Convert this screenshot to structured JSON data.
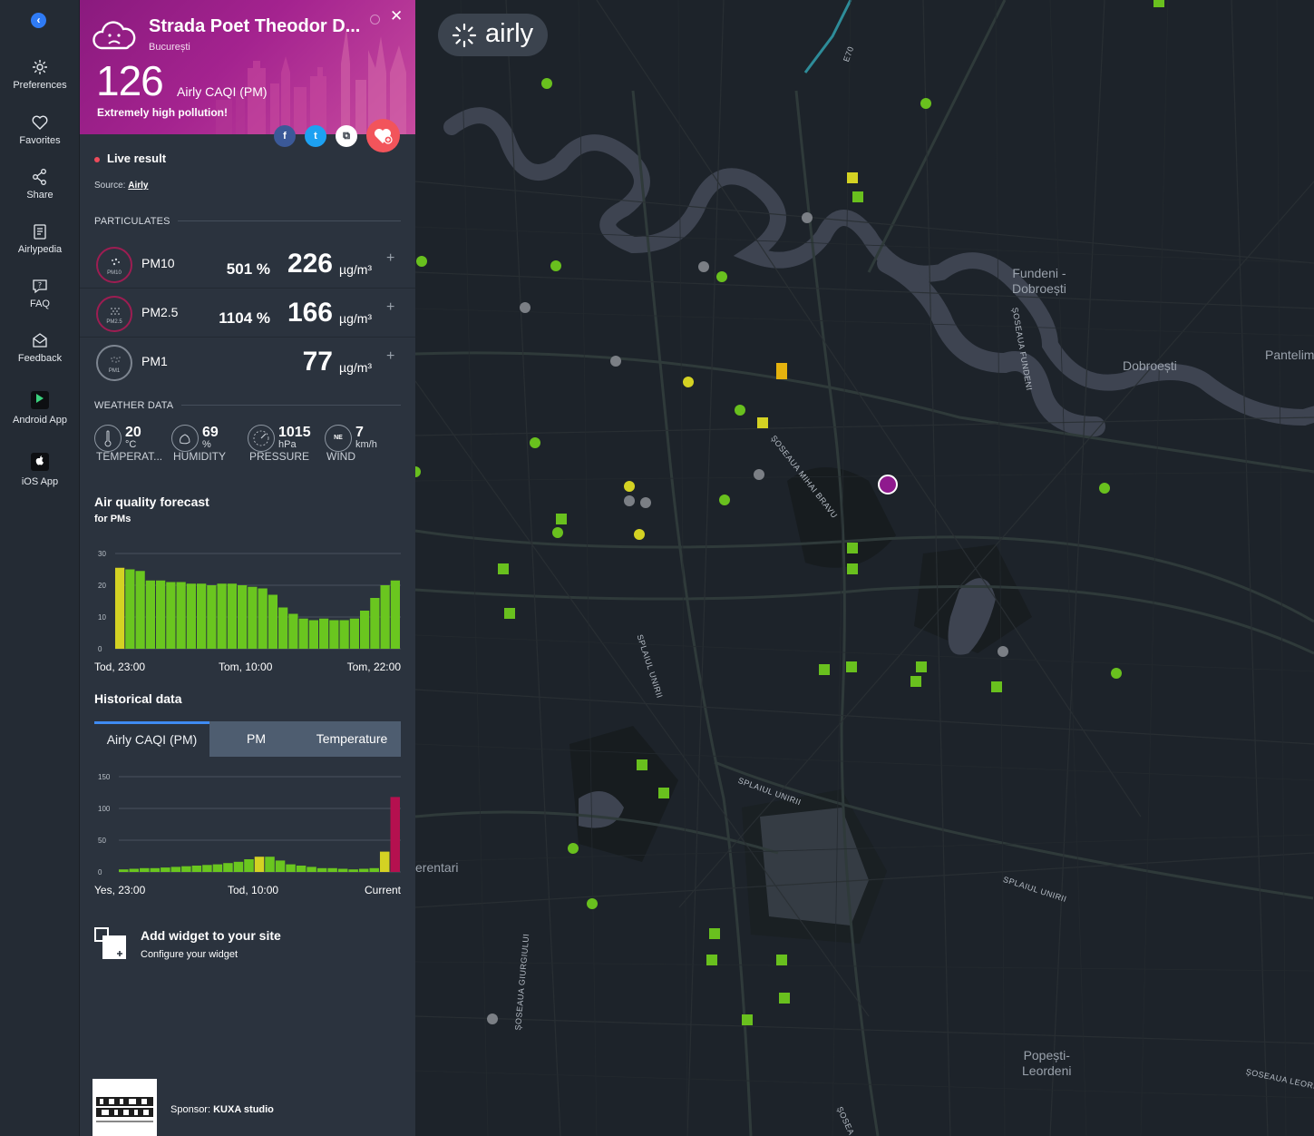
{
  "nav": {
    "items": [
      {
        "label": "Preferences",
        "icon": "gear-icon"
      },
      {
        "label": "Favorites",
        "icon": "heart-icon"
      },
      {
        "label": "Share",
        "icon": "share-icon"
      },
      {
        "label": "Airlypedia",
        "icon": "book-icon"
      },
      {
        "label": "FAQ",
        "icon": "question-icon"
      },
      {
        "label": "Feedback",
        "icon": "envelope-icon"
      },
      {
        "label": "Android App",
        "icon": "google-play-icon"
      },
      {
        "label": "iOS App",
        "icon": "apple-icon"
      }
    ]
  },
  "header": {
    "title": "Strada Poet Theodor D...",
    "city": "București",
    "caqi_value": "126",
    "caqi_label": "Airly CAQI (PM)",
    "level": "Extremely high pollution!",
    "color": "#a4238f",
    "social": [
      {
        "icon": "facebook-icon",
        "glyph": "f",
        "color": "#3b5998"
      },
      {
        "icon": "twitter-icon",
        "glyph": "t",
        "color": "#1da1f2"
      },
      {
        "icon": "copy-link-icon",
        "glyph": "⧉",
        "color": "#ffffff"
      }
    ]
  },
  "live": {
    "label": "Live result",
    "source_prefix": "Source:",
    "source": "Airly"
  },
  "particulates": {
    "title": "PARTICULATES",
    "rows": [
      {
        "name": "PM10",
        "badge": "PM10",
        "percent": "501 %",
        "value": "226",
        "unit": "µg/m³",
        "color": "#9d1d52"
      },
      {
        "name": "PM2.5",
        "badge": "PM2.5",
        "percent": "1104 %",
        "value": "166",
        "unit": "µg/m³",
        "color": "#9d1d52"
      },
      {
        "name": "PM1",
        "badge": "PM1",
        "percent": "",
        "value": "77",
        "unit": "µg/m³",
        "color": "#7d8590"
      }
    ]
  },
  "weather": {
    "title": "WEATHER DATA",
    "items": [
      {
        "icon": "thermometer-icon",
        "value": "20",
        "unit": "°C",
        "label": "TEMPERAT..."
      },
      {
        "icon": "humidity-icon",
        "value": "69",
        "unit": "%",
        "label": "HUMIDITY"
      },
      {
        "icon": "pressure-gauge-icon",
        "value": "1015",
        "unit": "hPa",
        "label": "PRESSURE"
      },
      {
        "icon": "compass-icon",
        "value": "7",
        "unit": "km/h",
        "label": "WIND",
        "direction": "NE"
      }
    ]
  },
  "forecast": {
    "title": "Air quality forecast",
    "subtitle": "for PMs",
    "x_labels": [
      "Tod, 23:00",
      "Tom, 10:00",
      "Tom, 22:00"
    ]
  },
  "historical": {
    "title": "Historical data",
    "tabs": [
      "Airly CAQI (PM)",
      "PM",
      "Temperature"
    ],
    "active_tab": 0,
    "x_labels": [
      "Yes, 23:00",
      "Tod, 10:00",
      "Current"
    ]
  },
  "widget": {
    "title": "Add widget to your site",
    "subtitle": "Configure your widget"
  },
  "sponsor": {
    "label": "Sponsor:",
    "name": "KUXA studio"
  },
  "map": {
    "brand": "airly",
    "places": [
      {
        "name": "Fundeni -\nDobroești"
      },
      {
        "name": "Dobroești"
      },
      {
        "name": "Pantelim"
      },
      {
        "name": "erentari"
      },
      {
        "name": "Popești-\nLeordeni"
      }
    ],
    "roads": [
      {
        "name": "ȘOSEAUA MIHAI BRAVU"
      },
      {
        "name": "ȘOSEAUA FUNDENI"
      },
      {
        "name": "SPLAIUL UNIRII"
      },
      {
        "name": "SPLAIUL UNIRII"
      },
      {
        "name": "SPLAIUL UNIRII"
      },
      {
        "name": "ȘOSEAUA GIURGIULUI"
      },
      {
        "name": "ȘOSEAUA LEORD"
      },
      {
        "name": "ȘOSEA"
      },
      {
        "name": "E70"
      }
    ],
    "marker_colors": {
      "good": "#69c01e",
      "moderate": "#d4d223",
      "high": "#e4b20e",
      "offline": "#7b7f85",
      "selected": "#8f1a8e"
    }
  },
  "chart_data": [
    {
      "type": "bar",
      "title": "Air quality forecast",
      "subtitle": "for PMs",
      "xlabel": "",
      "ylabel": "",
      "ylim": [
        0,
        30
      ],
      "yticks": [
        0,
        10,
        20,
        30
      ],
      "x_tick_labels": [
        "Tod, 23:00",
        "Tom, 10:00",
        "Tom, 22:00"
      ],
      "values": [
        25.5,
        25,
        24.5,
        21.5,
        21.5,
        21,
        21,
        20.5,
        20.5,
        20,
        20.5,
        20.5,
        20,
        19.5,
        19,
        17,
        13,
        11,
        9.5,
        9,
        9.5,
        9,
        9,
        9.5,
        12,
        16,
        20,
        21.5
      ],
      "colors": [
        "#d4d223",
        "#6ac61f",
        "#6ac61f",
        "#6ac61f",
        "#6ac61f",
        "#6ac61f",
        "#6ac61f",
        "#6ac61f",
        "#6ac61f",
        "#6ac61f",
        "#6ac61f",
        "#6ac61f",
        "#6ac61f",
        "#6ac61f",
        "#6ac61f",
        "#6ac61f",
        "#6ac61f",
        "#6ac61f",
        "#6ac61f",
        "#6ac61f",
        "#6ac61f",
        "#6ac61f",
        "#6ac61f",
        "#6ac61f",
        "#6ac61f",
        "#6ac61f",
        "#6ac61f",
        "#6ac61f"
      ],
      "grid": true
    },
    {
      "type": "bar",
      "title": "Historical data",
      "xlabel": "",
      "ylabel": "",
      "ylim": [
        0,
        150
      ],
      "yticks": [
        0,
        50,
        100,
        150
      ],
      "x_tick_labels": [
        "Yes, 23:00",
        "Tod, 10:00",
        "Current"
      ],
      "values": [
        4,
        5,
        6,
        6,
        7,
        8,
        9,
        10,
        11,
        12,
        14,
        16,
        20,
        24,
        24,
        18,
        12,
        10,
        8,
        6,
        6,
        5,
        4,
        5,
        6,
        32,
        118
      ],
      "colors": [
        "#6ac61f",
        "#6ac61f",
        "#6ac61f",
        "#6ac61f",
        "#6ac61f",
        "#6ac61f",
        "#6ac61f",
        "#6ac61f",
        "#6ac61f",
        "#6ac61f",
        "#6ac61f",
        "#6ac61f",
        "#6ac61f",
        "#d4d223",
        "#6ac61f",
        "#6ac61f",
        "#6ac61f",
        "#6ac61f",
        "#6ac61f",
        "#6ac61f",
        "#6ac61f",
        "#6ac61f",
        "#6ac61f",
        "#6ac61f",
        "#6ac61f",
        "#d4d223",
        "#b5104f"
      ],
      "grid": true
    }
  ]
}
